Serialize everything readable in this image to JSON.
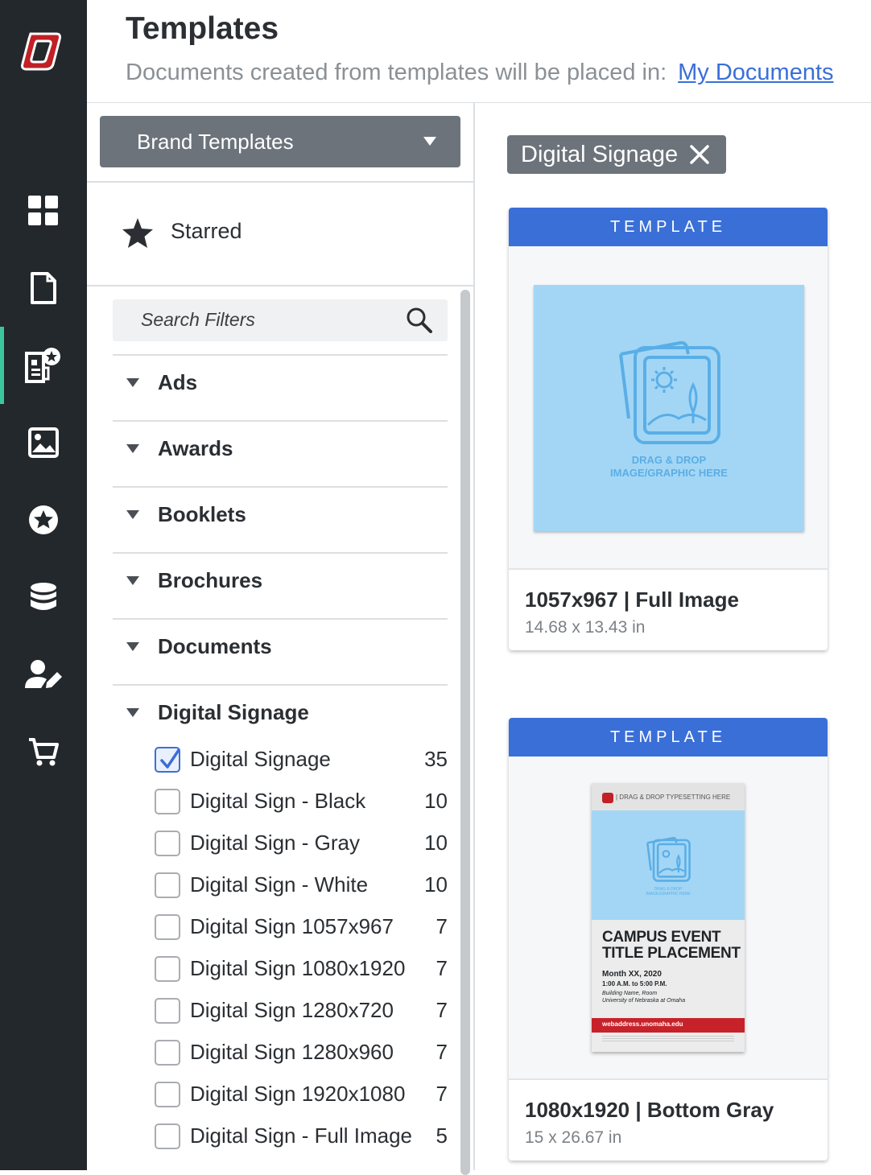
{
  "header": {
    "title": "Templates",
    "subtitle": "Documents created from templates will be placed in:",
    "link": "My Documents"
  },
  "rail": {
    "logo": "university-o-logo",
    "items": [
      {
        "icon": "dashboard-grid-icon",
        "active": false
      },
      {
        "icon": "document-icon",
        "active": false
      },
      {
        "icon": "templates-starred-doc-icon",
        "active": true
      },
      {
        "icon": "image-icon",
        "active": false
      },
      {
        "icon": "star-circle-icon",
        "active": false
      },
      {
        "icon": "database-icon",
        "active": false
      },
      {
        "icon": "user-edit-icon",
        "active": false
      },
      {
        "icon": "cart-icon",
        "active": false
      }
    ]
  },
  "filters": {
    "select_value": "Brand Templates",
    "starred_label": "Starred",
    "search_placeholder": "Search Filters",
    "categories": [
      "Ads",
      "Awards",
      "Booklets",
      "Brochures",
      "Documents",
      "Digital Signage"
    ],
    "options": [
      {
        "label": "Digital Signage",
        "count": "35",
        "checked": true
      },
      {
        "label": "Digital Sign - Black",
        "count": "10",
        "checked": false
      },
      {
        "label": "Digital Sign - Gray",
        "count": "10",
        "checked": false
      },
      {
        "label": "Digital Sign - White",
        "count": "10",
        "checked": false
      },
      {
        "label": "Digital Sign 1057x967",
        "count": "7",
        "checked": false
      },
      {
        "label": "Digital Sign 1080x1920",
        "count": "7",
        "checked": false
      },
      {
        "label": "Digital Sign 1280x720",
        "count": "7",
        "checked": false
      },
      {
        "label": "Digital Sign 1280x960",
        "count": "7",
        "checked": false
      },
      {
        "label": "Digital Sign 1920x1080",
        "count": "7",
        "checked": false
      },
      {
        "label": "Digital Sign - Full Image",
        "count": "5",
        "checked": false
      }
    ]
  },
  "active_filter_chip": "Digital Signage",
  "cards": [
    {
      "tag": "TEMPLATE",
      "title": "1057x967 | Full Image",
      "dimensions": "14.68 x 13.43 in",
      "thumb_lines": [
        "DRAG & DROP",
        "IMAGE/GRAPHIC HERE"
      ]
    },
    {
      "tag": "TEMPLATE",
      "title": "1080x1920 | Bottom Gray",
      "dimensions": "15 x 26.67 in",
      "thumb": {
        "header": "| DRAG & DROP TYPESETTING HERE",
        "photo_lines": [
          "DRAG & DROP",
          "IMAGE/GRAPHIC HERE"
        ],
        "event_line1": "CAMPUS EVENT",
        "event_line2": "TITLE PLACEMENT",
        "date": "Month XX, 2020",
        "time": "1:00 A.M. to 5:00 P.M.",
        "building": "Building Name, Room",
        "university": "University of Nebraska at Omaha",
        "web": "webaddress.unomaha.edu"
      }
    }
  ],
  "colors": {
    "rail": "#23282d",
    "accent_blue": "#3a6fd8",
    "active_indicator": "#3cc6a0",
    "select_gray": "#6c737b",
    "brand_red": "#c12026"
  }
}
